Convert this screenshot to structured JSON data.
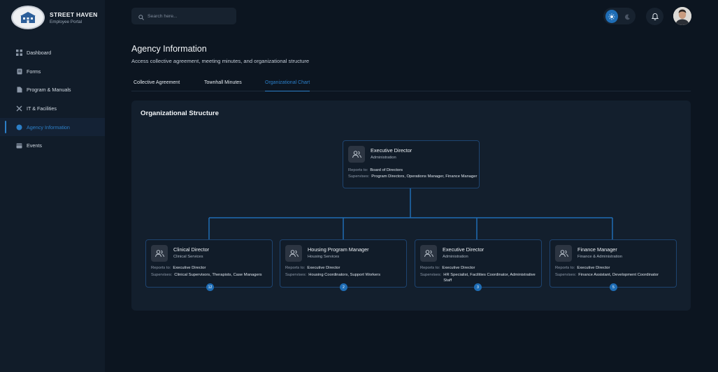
{
  "brand": {
    "title": "STREET HAVEN",
    "subtitle": "Employee Portal"
  },
  "nav": [
    {
      "label": "Dashboard",
      "icon": "grid-icon"
    },
    {
      "label": "Forms",
      "icon": "document-icon"
    },
    {
      "label": "Program & Manuals",
      "icon": "book-icon"
    },
    {
      "label": "IT & Facilities",
      "icon": "tools-icon"
    },
    {
      "label": "Agency Information",
      "icon": "info-icon",
      "active": true
    },
    {
      "label": "Events",
      "icon": "calendar-icon"
    }
  ],
  "search": {
    "placeholder": "Search here..."
  },
  "header": {
    "title": "Agency Information",
    "subtitle": "Access collective agreement, meeting minutes, and organizational structure"
  },
  "tabs": [
    {
      "label": "Collective Agreement"
    },
    {
      "label": "Townhall Minutes"
    },
    {
      "label": "Organizational Chart",
      "active": true
    }
  ],
  "org": {
    "title": "Organizational Structure",
    "reports_label": "Reports to:",
    "supervises_label": "Supervises:",
    "root": {
      "title": "Executive Director",
      "department": "Administration",
      "reports_to": "Board of Directors",
      "supervises": "Program Directors, Operations Manager, Finance Manager"
    },
    "children": [
      {
        "title": "Clinical Director",
        "department": "Clinical Services",
        "reports_to": "Executive Director",
        "supervises": "Clinical Supervisors, Therapists, Case Managers",
        "count": "12"
      },
      {
        "title": "Housing Program Manager",
        "department": "Housing Services",
        "reports_to": "Executive Director",
        "supervises": "Housing Coordinators, Support Workers",
        "count": "2"
      },
      {
        "title": "Executive Director",
        "department": "Administration",
        "reports_to": "Executive Director",
        "supervises": "HR Specialist, Facilities Coordinator, Administrative Staff",
        "count": "3"
      },
      {
        "title": "Finance Manager",
        "department": "Finance & Administration",
        "reports_to": "Executive Director",
        "supervises": "Finance Assistant, Development Coordinator",
        "count": "5"
      }
    ]
  },
  "colors": {
    "accent": "#2b7fc9",
    "background": "#0c1520",
    "sidebar": "#111c29",
    "panel": "#131f2d",
    "card_border": "#1e4470"
  }
}
